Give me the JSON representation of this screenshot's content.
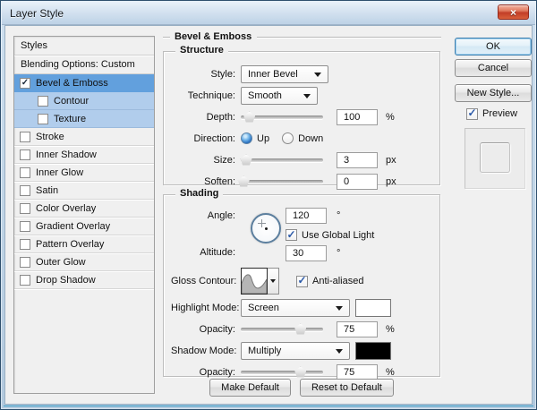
{
  "window": {
    "title": "Layer Style",
    "close_glyph": "×"
  },
  "colors": {
    "selected_row": "#62a0dd",
    "highlight_row": "#b1cdec",
    "highlight_swatch": "#ffffff",
    "shadow_swatch": "#000000"
  },
  "sidebar": {
    "header": "Styles",
    "blending": "Blending Options: Custom",
    "items": [
      {
        "label": "Bevel & Emboss",
        "checked": true,
        "selected": true,
        "indent": false
      },
      {
        "label": "Contour",
        "checked": false,
        "highlight": true,
        "indent": true
      },
      {
        "label": "Texture",
        "checked": false,
        "highlight": true,
        "indent": true
      },
      {
        "label": "Stroke",
        "checked": false
      },
      {
        "label": "Inner Shadow",
        "checked": false
      },
      {
        "label": "Inner Glow",
        "checked": false
      },
      {
        "label": "Satin",
        "checked": false
      },
      {
        "label": "Color Overlay",
        "checked": false
      },
      {
        "label": "Gradient Overlay",
        "checked": false
      },
      {
        "label": "Pattern Overlay",
        "checked": false
      },
      {
        "label": "Outer Glow",
        "checked": false
      },
      {
        "label": "Drop Shadow",
        "checked": false
      }
    ]
  },
  "main": {
    "header": "Bevel & Emboss",
    "structure": {
      "legend": "Structure",
      "style_label": "Style:",
      "style_value": "Inner Bevel",
      "technique_label": "Technique:",
      "technique_value": "Smooth",
      "depth_label": "Depth:",
      "depth_value": "100",
      "depth_unit": "%",
      "direction_label": "Direction:",
      "direction_up": "Up",
      "direction_down": "Down",
      "size_label": "Size:",
      "size_value": "3",
      "size_unit": "px",
      "soften_label": "Soften:",
      "soften_value": "0",
      "soften_unit": "px"
    },
    "shading": {
      "legend": "Shading",
      "angle_label": "Angle:",
      "angle_value": "120",
      "angle_unit": "°",
      "use_global_light_label": "Use Global Light",
      "altitude_label": "Altitude:",
      "altitude_value": "30",
      "altitude_unit": "°",
      "gloss_label": "Gloss Contour:",
      "anti_aliased_label": "Anti-aliased",
      "highlight_label": "Highlight Mode:",
      "highlight_value": "Screen",
      "opacity1_label": "Opacity:",
      "opacity1_value": "75",
      "opacity1_unit": "%",
      "shadow_label": "Shadow Mode:",
      "shadow_value": "Multiply",
      "opacity2_label": "Opacity:",
      "opacity2_value": "75",
      "opacity2_unit": "%"
    },
    "footer": {
      "make_default": "Make Default",
      "reset_default": "Reset to Default"
    }
  },
  "actions": {
    "ok": "OK",
    "cancel": "Cancel",
    "new_style": "New Style...",
    "preview": "Preview"
  },
  "sliders": {
    "depth": 10,
    "size": 6,
    "soften": 3,
    "opacity_highlight": 72,
    "opacity_shadow": 72
  }
}
